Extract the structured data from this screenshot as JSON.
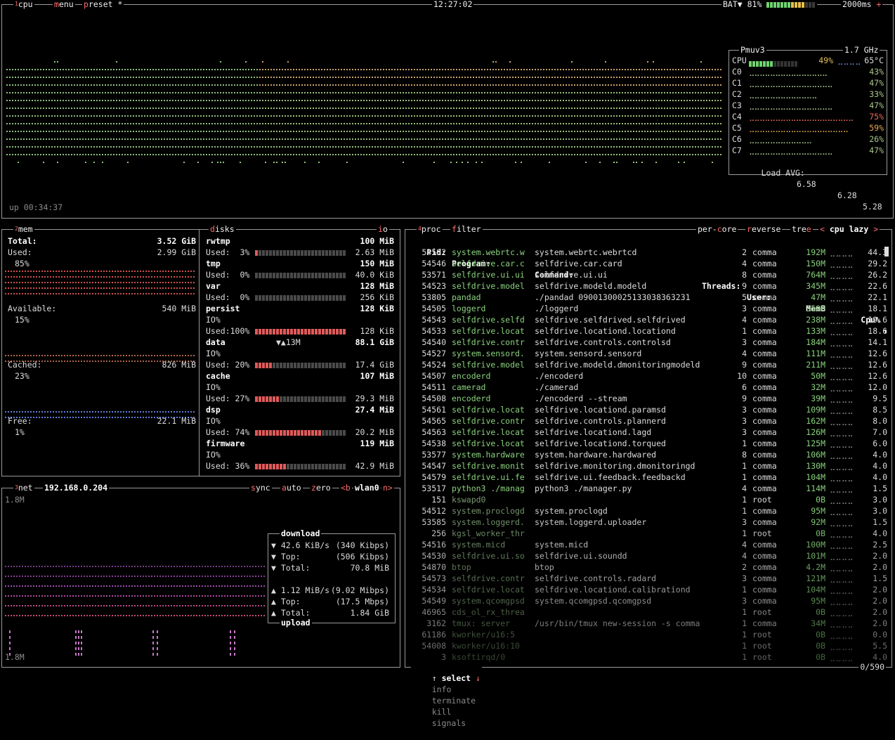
{
  "header": {
    "cpu_num": "1",
    "cpu_title": "cpu",
    "menu_hk": "m",
    "menu_rest": "enu",
    "preset_hk": "p",
    "preset_rest": "reset",
    "preset_mark": "*",
    "clock": "12:27:02",
    "battery_label": "BAT▼ 81%",
    "battery_level": 0.81,
    "update_ms": "2000ms",
    "plus": "+"
  },
  "cpu": {
    "uptime": "up 00:34:37",
    "model": "Pmuv3",
    "freq": "1.7 GHz",
    "total": {
      "label": "CPU",
      "pct": "49%",
      "temp": "65°C",
      "value": 0.49
    },
    "cores": [
      {
        "label": "C0",
        "pct": "43%",
        "value": 0.43
      },
      {
        "label": "C1",
        "pct": "47%",
        "value": 0.47
      },
      {
        "label": "C2",
        "pct": "33%",
        "value": 0.33
      },
      {
        "label": "C3",
        "pct": "47%",
        "value": 0.47
      },
      {
        "label": "C4",
        "pct": "75%",
        "value": 0.75
      },
      {
        "label": "C5",
        "pct": "59%",
        "value": 0.59
      },
      {
        "label": "C6",
        "pct": "26%",
        "value": 0.26
      },
      {
        "label": "C7",
        "pct": "47%",
        "value": 0.47
      }
    ],
    "load_label": "Load AVG:",
    "load1": "6.58",
    "load5": "6.28",
    "load15": "5.28"
  },
  "mem": {
    "num": "2",
    "title": "mem",
    "total_label": "Total:",
    "total": "3.52 GiB",
    "used_label": "Used:",
    "used": "2.99 GiB",
    "used_pct": "85%",
    "avail_label": "Available:",
    "avail": "540 MiB",
    "avail_pct": "15%",
    "cached_label": "Cached:",
    "cached": "826 MiB",
    "cached_pct": "23%",
    "free_label": "Free:",
    "free": "22.1 MiB",
    "free_pct": "1%"
  },
  "disks": {
    "title_hk": "d",
    "title_rest": "isks",
    "io_hk": "i",
    "io_rest": "o",
    "items": [
      {
        "name": "rwtmp",
        "size": "100 MiB",
        "used_line": "Used:  3%",
        "used": "2.63 MiB",
        "value": 0.03,
        "io": ""
      },
      {
        "name": "tmp",
        "size": "150 MiB",
        "used_line": "Used:  0%",
        "used": "40.0 KiB",
        "value": 0.0,
        "io": ""
      },
      {
        "name": "var",
        "size": "128 MiB",
        "used_line": "Used:  0%",
        "used": "256 KiB",
        "value": 0.0,
        "io": ""
      },
      {
        "name": "persist",
        "size": "128 KiB",
        "used_line": "Used:100%",
        "used": "128 KiB",
        "value": 1.0,
        "io": "IO%"
      },
      {
        "name": "data",
        "size": "88.1 GiB",
        "used_line": "Used: 20%",
        "used": "17.4 GiB",
        "value": 0.2,
        "io": "IO%",
        "rate": "▼▲13M"
      },
      {
        "name": "cache",
        "size": "107 MiB",
        "used_line": "Used: 27%",
        "used": "29.3 MiB",
        "value": 0.27,
        "io": "IO%"
      },
      {
        "name": "dsp",
        "size": "27.4 MiB",
        "used_line": "Used: 74%",
        "used": "20.2 MiB",
        "value": 0.74,
        "io": "IO%"
      },
      {
        "name": "firmware",
        "size": "119 MiB",
        "used_line": "Used: 36%",
        "used": "42.9 MiB",
        "value": 0.36,
        "io": "IO%"
      }
    ]
  },
  "net": {
    "num": "3",
    "title": "net",
    "ip": "192.168.0.204",
    "sync_hk": "s",
    "sync_rest": "ync",
    "auto_hk": "a",
    "auto_rest": "uto",
    "zero_hk": "z",
    "zero_rest": "ero",
    "prev": "<b",
    "iface": "wlan0",
    "next": "n>",
    "scale_top": "1.8M",
    "scale_bottom": "1.8M",
    "download_title": "download",
    "upload_title": "upload",
    "down_rate": "▼ 42.6 KiB/s",
    "down_rate_bits": "(340 Kibps)",
    "down_top_label": "▼ Top:",
    "down_top": "(506 Kibps)",
    "down_total_label": "▼ Total:",
    "down_total": "70.8 MiB",
    "up_rate": "▲ 1.12 MiB/s",
    "up_rate_bits": "(9.02 Mibps)",
    "up_top_label": "▲ Top:",
    "up_top": "(17.5 Mbps)",
    "up_total_label": "▲ Total:",
    "up_total": "1.84 GiB"
  },
  "proc": {
    "num": "4",
    "title": "proc",
    "filter_hk": "f",
    "filter_rest": "ilter",
    "percore_a": "per-",
    "percore_hk": "c",
    "percore_b": "ore",
    "reverse_hk": "r",
    "reverse_rest": "everse",
    "tree_a": "tre",
    "tree_hk": "e",
    "sort_prev": "<",
    "sort": "cpu lazy",
    "sort_next": ">",
    "headers": {
      "pid": "Pid:",
      "program": "Program:",
      "command": "Command:",
      "threads": "Threads:",
      "user": "User:",
      "mem": "MemB",
      "cpu": "Cpu%",
      "arrow": "↑"
    },
    "rows": [
      {
        "pid": "54582",
        "program": "system.webrtc.w",
        "command": "system.webrtc.webrtcd",
        "threads": "2",
        "user": "comma",
        "mem": "192M",
        "cpu": "44.3"
      },
      {
        "pid": "54546",
        "program": "selfdrive.car.c",
        "command": "selfdrive.car.card",
        "threads": "4",
        "user": "comma",
        "mem": "150M",
        "cpu": "29.2"
      },
      {
        "pid": "53571",
        "program": "selfdrive.ui.ui",
        "command": "selfdrive.ui.ui",
        "threads": "8",
        "user": "comma",
        "mem": "764M",
        "cpu": "26.2"
      },
      {
        "pid": "54523",
        "program": "selfdrive.model",
        "command": "selfdrive.modeld.modeld",
        "threads": "9",
        "user": "comma",
        "mem": "345M",
        "cpu": "22.6"
      },
      {
        "pid": "53805",
        "program": "pandad",
        "command": "./pandad 09001300025133038363231",
        "threads": "5",
        "user": "comma",
        "mem": "47M",
        "cpu": "22.1"
      },
      {
        "pid": "54505",
        "program": "loggerd",
        "command": "./loggerd",
        "threads": "3",
        "user": "comma",
        "mem": "358M",
        "cpu": "18.1"
      },
      {
        "pid": "54543",
        "program": "selfdrive.selfd",
        "command": "selfdrive.selfdrived.selfdrived",
        "threads": "4",
        "user": "comma",
        "mem": "238M",
        "cpu": "19.6"
      },
      {
        "pid": "54533",
        "program": "selfdrive.locat",
        "command": "selfdrive.locationd.locationd",
        "threads": "1",
        "user": "comma",
        "mem": "133M",
        "cpu": "18.6"
      },
      {
        "pid": "54540",
        "program": "selfdrive.contr",
        "command": "selfdrive.controls.controlsd",
        "threads": "3",
        "user": "comma",
        "mem": "184M",
        "cpu": "14.1"
      },
      {
        "pid": "54527",
        "program": "system.sensord.",
        "command": "system.sensord.sensord",
        "threads": "4",
        "user": "comma",
        "mem": "111M",
        "cpu": "12.6"
      },
      {
        "pid": "54524",
        "program": "selfdrive.model",
        "command": "selfdrive.modeld.dmonitoringmodeld",
        "threads": "9",
        "user": "comma",
        "mem": "211M",
        "cpu": "12.6"
      },
      {
        "pid": "54507",
        "program": "encoderd",
        "command": "./encoderd",
        "threads": "10",
        "user": "comma",
        "mem": "50M",
        "cpu": "12.6"
      },
      {
        "pid": "54511",
        "program": "camerad",
        "command": "./camerad",
        "threads": "6",
        "user": "comma",
        "mem": "32M",
        "cpu": "12.0"
      },
      {
        "pid": "54508",
        "program": "encoderd",
        "command": "./encoderd --stream",
        "threads": "9",
        "user": "comma",
        "mem": "39M",
        "cpu": "9.5"
      },
      {
        "pid": "54561",
        "program": "selfdrive.locat",
        "command": "selfdrive.locationd.paramsd",
        "threads": "3",
        "user": "comma",
        "mem": "109M",
        "cpu": "8.5"
      },
      {
        "pid": "54565",
        "program": "selfdrive.contr",
        "command": "selfdrive.controls.plannerd",
        "threads": "3",
        "user": "comma",
        "mem": "162M",
        "cpu": "8.0"
      },
      {
        "pid": "54563",
        "program": "selfdrive.locat",
        "command": "selfdrive.locationd.lagd",
        "threads": "3",
        "user": "comma",
        "mem": "126M",
        "cpu": "7.0"
      },
      {
        "pid": "54538",
        "program": "selfdrive.locat",
        "command": "selfdrive.locationd.torqued",
        "threads": "1",
        "user": "comma",
        "mem": "125M",
        "cpu": "6.0"
      },
      {
        "pid": "53577",
        "program": "system.hardware",
        "command": "system.hardware.hardwared",
        "threads": "8",
        "user": "comma",
        "mem": "106M",
        "cpu": "4.0"
      },
      {
        "pid": "54547",
        "program": "selfdrive.monit",
        "command": "selfdrive.monitoring.dmonitoringd",
        "threads": "1",
        "user": "comma",
        "mem": "130M",
        "cpu": "4.0"
      },
      {
        "pid": "54579",
        "program": "selfdrive.ui.fe",
        "command": "selfdrive.ui.feedback.feedbackd",
        "threads": "1",
        "user": "comma",
        "mem": "104M",
        "cpu": "4.0"
      },
      {
        "pid": "53517",
        "program": "python3 ./manag",
        "command": "python3 ./manager.py",
        "threads": "4",
        "user": "comma",
        "mem": "114M",
        "cpu": "1.5"
      },
      {
        "pid": "151",
        "program": "kswapd0",
        "command": "",
        "threads": "1",
        "user": "root",
        "mem": "0B",
        "cpu": "3.0"
      },
      {
        "pid": "54512",
        "program": "system.proclogd",
        "command": "system.proclogd",
        "threads": "1",
        "user": "comma",
        "mem": "95M",
        "cpu": "3.0"
      },
      {
        "pid": "53585",
        "program": "system.loggerd.",
        "command": "system.loggerd.uploader",
        "threads": "3",
        "user": "comma",
        "mem": "92M",
        "cpu": "1.5"
      },
      {
        "pid": "256",
        "program": "kgsl_worker_thr",
        "command": "",
        "threads": "1",
        "user": "root",
        "mem": "0B",
        "cpu": "4.0"
      },
      {
        "pid": "54516",
        "program": "system.micd",
        "command": "system.micd",
        "threads": "4",
        "user": "comma",
        "mem": "100M",
        "cpu": "2.5"
      },
      {
        "pid": "54530",
        "program": "selfdrive.ui.so",
        "command": "selfdrive.ui.soundd",
        "threads": "4",
        "user": "comma",
        "mem": "101M",
        "cpu": "2.0"
      },
      {
        "pid": "54870",
        "program": "btop",
        "command": "btop",
        "threads": "2",
        "user": "comma",
        "mem": "4.2M",
        "cpu": "2.0"
      },
      {
        "pid": "54573",
        "program": "selfdrive.contr",
        "command": "selfdrive.controls.radard",
        "threads": "3",
        "user": "comma",
        "mem": "121M",
        "cpu": "1.5"
      },
      {
        "pid": "54534",
        "program": "selfdrive.locat",
        "command": "selfdrive.locationd.calibrationd",
        "threads": "1",
        "user": "comma",
        "mem": "104M",
        "cpu": "2.0"
      },
      {
        "pid": "54549",
        "program": "system.qcomgpsd",
        "command": "system.qcomgpsd.qcomgpsd",
        "threads": "3",
        "user": "comma",
        "mem": "95M",
        "cpu": "2.0"
      },
      {
        "pid": "46965",
        "program": "cds_ol_rx_threa",
        "command": "",
        "threads": "1",
        "user": "root",
        "mem": "0B",
        "cpu": "2.0"
      },
      {
        "pid": "3162",
        "program": "tmux: server",
        "command": "/usr/bin/tmux new-session -s comma -d",
        "threads": "1",
        "user": "comma",
        "mem": "34M",
        "cpu": "2.0"
      },
      {
        "pid": "61186",
        "program": "kworker/u16:5",
        "command": "",
        "threads": "1",
        "user": "root",
        "mem": "0B",
        "cpu": "0.0"
      },
      {
        "pid": "54008",
        "program": "kworker/u16:10",
        "command": "",
        "threads": "1",
        "user": "root",
        "mem": "0B",
        "cpu": "5.5"
      },
      {
        "pid": "3",
        "program": "ksoftirqd/0",
        "command": "",
        "threads": "1",
        "user": "root",
        "mem": "0B",
        "cpu": "4.0"
      }
    ],
    "footer_select": "select",
    "footer_info": "info",
    "footer_terminate": "terminate",
    "footer_kill": "kill",
    "footer_signals": "signals",
    "counter": "0/590"
  }
}
